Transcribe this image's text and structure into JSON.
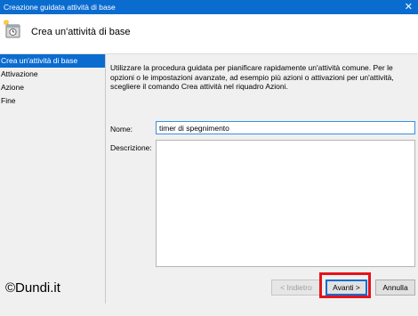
{
  "window": {
    "title": "Creazione guidata attività di base",
    "close_glyph": "✕"
  },
  "header": {
    "icon": "task-wizard-icon",
    "title": "Crea un'attività di base"
  },
  "nav": {
    "items": [
      {
        "label": "Crea un'attività di base",
        "active": true
      },
      {
        "label": "Attivazione",
        "active": false
      },
      {
        "label": "Azione",
        "active": false
      },
      {
        "label": "Fine",
        "active": false
      }
    ]
  },
  "main": {
    "description": "Utilizzare la procedura guidata per pianificare rapidamente un'attività comune. Per le opzioni o le impostazioni avanzate, ad esempio più azioni o attivazioni per un'attività, scegliere il comando Crea attività nel riquadro Azioni.",
    "name_label": "Nome:",
    "name_value": "timer di spegnimento",
    "description_label": "Descrizione:",
    "description_value": ""
  },
  "footer": {
    "watermark": "©Dundi.it",
    "back_label": "< Indietro",
    "next_label": "Avanti >",
    "cancel_label": "Annulla"
  },
  "colors": {
    "accent": "#0b6cd0",
    "highlight": "#e4141b"
  }
}
